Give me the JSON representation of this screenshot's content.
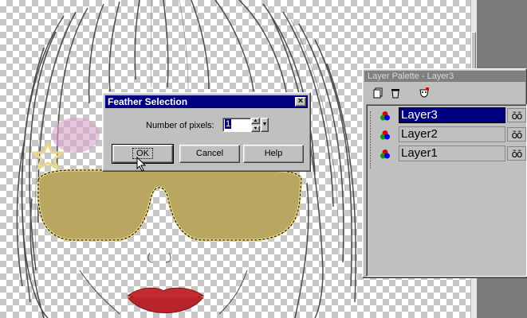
{
  "dialog": {
    "title": "Feather Selection",
    "close_label": "×",
    "field_label": "Number of pixels:",
    "field_value": "1",
    "ok_label": "OK",
    "cancel_label": "Cancel",
    "help_label": "Help"
  },
  "palette": {
    "title": "Layer Palette - Layer3",
    "toolbar_icons": [
      "new-layer-icon",
      "delete-layer-icon",
      "mask-icon"
    ],
    "layers": [
      {
        "name": "Layer3",
        "selected": true,
        "visibility_glyph": "õõ"
      },
      {
        "name": "Layer2",
        "selected": false,
        "visibility_glyph": "õõ"
      },
      {
        "name": "Layer1",
        "selected": false,
        "visibility_glyph": "õõ"
      }
    ]
  },
  "colors": {
    "titlebar_active": "#000080",
    "titlebar_inactive": "#808080",
    "face": "#c0c0c0",
    "workspace": "#7b7b7b",
    "glasses": "#b9a661",
    "lips": "#c42a2e"
  }
}
